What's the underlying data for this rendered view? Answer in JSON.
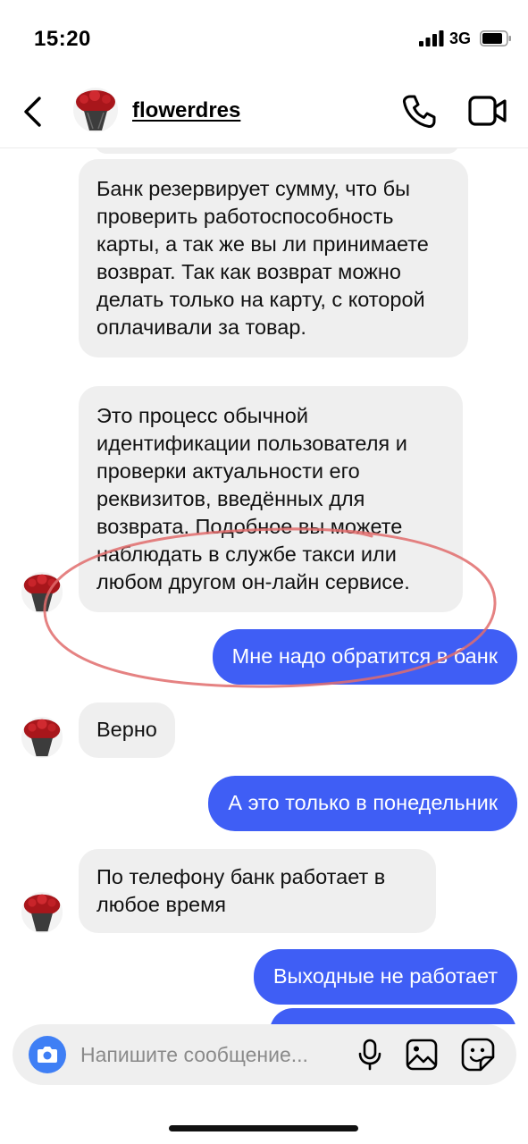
{
  "status_bar": {
    "time": "15:20",
    "network": "3G",
    "icons": [
      "signal-icon",
      "battery-icon"
    ]
  },
  "header": {
    "username": "flowerdres",
    "icons": [
      "back-icon",
      "avatar",
      "call-icon",
      "video-call-icon"
    ]
  },
  "messages": [
    {
      "direction": "incoming",
      "text": "Банк резервирует сумму, что бы проверить работоспособность карты, а так же вы ли принимаете возврат. Так как возврат можно делать только на карту, с которой оплачивали за товар."
    },
    {
      "direction": "incoming",
      "text": "Это процесс обычной идентификации пользователя и проверки актуальности его реквизитов, введённых для возврата. Подобное вы можете наблюдать в службе такси или любом другом он-лайн сервисе."
    },
    {
      "direction": "outgoing",
      "text": "Мне надо обратится в банк"
    },
    {
      "direction": "incoming",
      "text": "Верно"
    },
    {
      "direction": "outgoing",
      "text": "А это только в понедельник"
    },
    {
      "direction": "incoming",
      "text": "По телефону банк работает в любое время"
    },
    {
      "direction": "outgoing",
      "text": "Выходные не работает"
    }
  ],
  "composer": {
    "placeholder": "Напишите сообщение...",
    "icons": [
      "camera-icon",
      "microphone-icon",
      "gallery-icon",
      "sticker-icon"
    ]
  },
  "colors": {
    "outgoing_bubble": "#3f5ef5",
    "incoming_bubble": "#efefef",
    "camera_button": "#3f7ff5",
    "highlight_ellipse": "#e06c6c"
  }
}
